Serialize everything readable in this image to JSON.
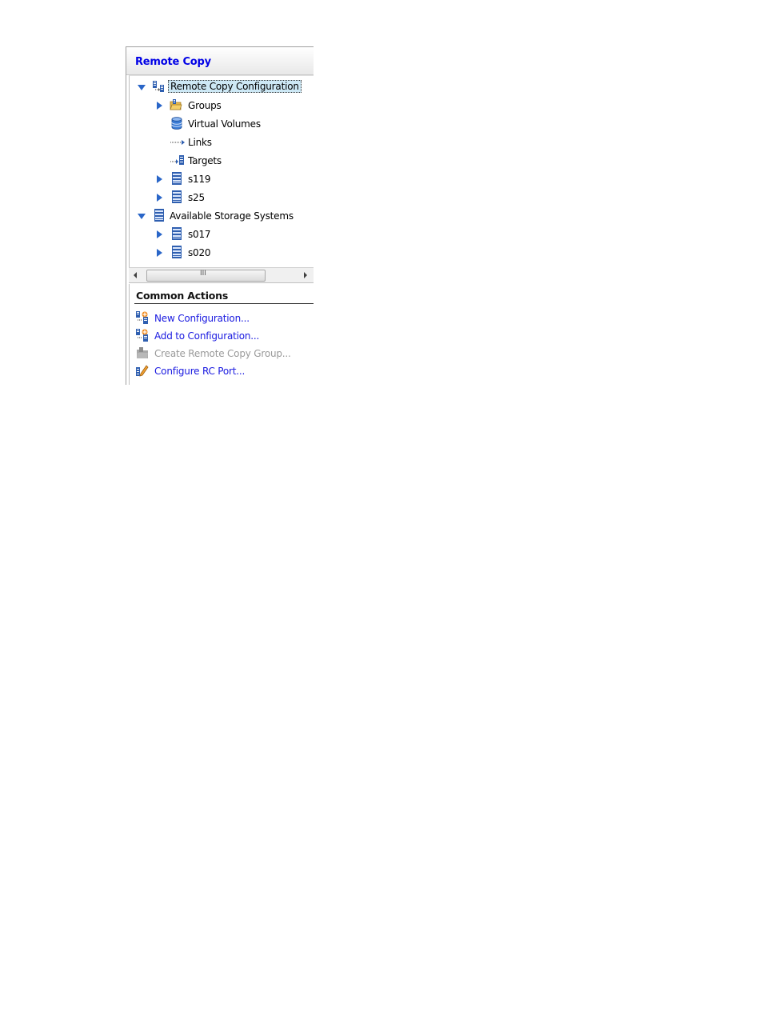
{
  "panel": {
    "title": "Remote Copy",
    "tree": [
      {
        "label": "Remote Copy Configuration",
        "icon": "rc-config-icon",
        "expander": "expanded",
        "selected": true
      },
      {
        "label": "Groups",
        "icon": "folder-icon",
        "expander": "collapsed"
      },
      {
        "label": "Virtual Volumes",
        "icon": "database-icon",
        "expander": "none"
      },
      {
        "label": "Links",
        "icon": "link-arrow-icon",
        "expander": "none"
      },
      {
        "label": "Targets",
        "icon": "target-icon",
        "expander": "none"
      },
      {
        "label": "s119",
        "icon": "storage-system-icon",
        "expander": "collapsed"
      },
      {
        "label": "s25",
        "icon": "storage-system-icon",
        "expander": "collapsed"
      },
      {
        "label": "Available Storage Systems",
        "icon": "storage-system-icon",
        "expander": "expanded"
      },
      {
        "label": "s017",
        "icon": "storage-system-icon",
        "expander": "collapsed"
      },
      {
        "label": "s020",
        "icon": "storage-system-icon",
        "expander": "collapsed"
      }
    ],
    "scroll_grip": "III"
  },
  "common_actions": {
    "title": "Common Actions",
    "items": [
      {
        "label": "New Configuration...",
        "icon": "new-config-icon",
        "enabled": true
      },
      {
        "label": "Add to Configuration...",
        "icon": "add-config-icon",
        "enabled": true
      },
      {
        "label": "Create Remote Copy Group...",
        "icon": "create-group-icon",
        "enabled": false
      },
      {
        "label": "Configure RC Port...",
        "icon": "configure-port-icon",
        "enabled": true
      }
    ]
  },
  "colors": {
    "title": "#0000e6",
    "link": "#1a1ae0",
    "disabled": "#9a9a9a",
    "expander": "#2a66c8",
    "selection": "#cde8f5"
  }
}
